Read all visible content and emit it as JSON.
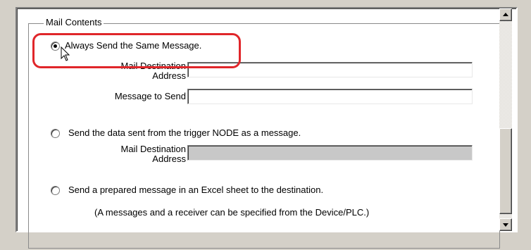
{
  "mail_contents": {
    "title": "Mail Contents",
    "option_always": {
      "label": "Always Send the Same Message.",
      "selected": true,
      "destination_label_1": "Mail Destination",
      "destination_label_2": "Address",
      "destination_value": "",
      "message_label": "Message to Send",
      "message_value": ""
    },
    "option_trigger": {
      "label": "Send the data sent from the trigger NODE as a message.",
      "selected": false,
      "destination_label_1": "Mail Destination",
      "destination_label_2": "Address",
      "destination_value": ""
    },
    "option_excel": {
      "label": "Send a prepared message in an Excel sheet to the destination.",
      "selected": false,
      "note": "(A messages and a receiver can be specified from the Device/PLC.)"
    }
  },
  "colors": {
    "highlight": "#e0262a",
    "dialog_bg": "#d4d0c8"
  },
  "icons": {
    "scroll_up": "triangle-up",
    "scroll_down": "triangle-down",
    "cursor": "arrow-pointer"
  }
}
